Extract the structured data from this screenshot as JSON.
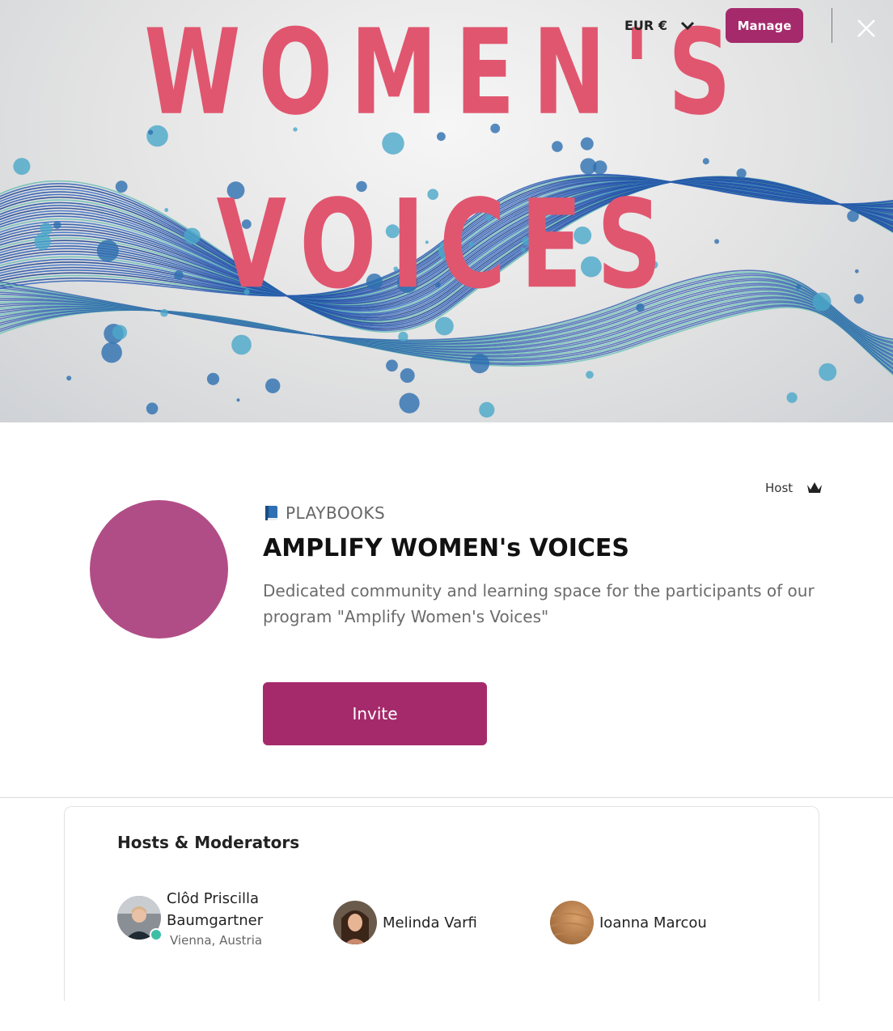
{
  "header": {
    "banner_line1": "WOMEN'S",
    "banner_line2": "VOICES",
    "currency_label": "EUR €",
    "manage_label": "Manage",
    "icons": {
      "currency": "chevron-down-icon",
      "close": "close-icon"
    }
  },
  "group": {
    "host_label": "Host",
    "host_icon": "crown-icon",
    "category_icon": "blue-book-icon",
    "category": "PLAYBOOKS",
    "title": "AMPLIFY WOMEN's VOICES",
    "description": "Dedicated community and learning space for the participants of our program \"Amplify Women's Voices\"",
    "avatar_color": "#b14d86",
    "invite_label": "Invite"
  },
  "hosts": {
    "heading": "Hosts & Moderators",
    "members": [
      {
        "name_line1": "Clôd Priscilla",
        "name_line2": "Baumgartner",
        "location": "Vienna, Austria",
        "online": true
      },
      {
        "name": "Melinda Varfi"
      },
      {
        "name": "Ioanna Marcou"
      }
    ]
  },
  "colors": {
    "accent": "#a52a6b",
    "banner_text": "#e0566f",
    "online": "#3dbfa6"
  }
}
